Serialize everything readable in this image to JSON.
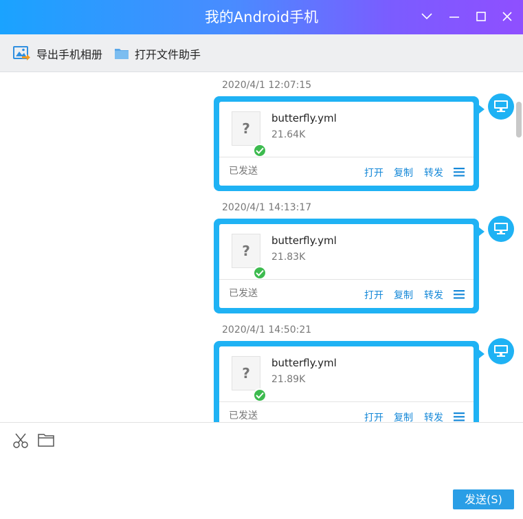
{
  "window": {
    "title": "我的Android手机",
    "controls": [
      {
        "name": "minimize-chevron",
        "icon": "chevron-down-icon"
      },
      {
        "name": "minimize",
        "icon": "minus-icon"
      },
      {
        "name": "maximize",
        "icon": "square-icon"
      },
      {
        "name": "close",
        "icon": "close-icon"
      }
    ]
  },
  "toolbar": {
    "export_album": {
      "label": "导出手机相册",
      "icon": "image-export-icon"
    },
    "open_file_helper": {
      "label": "打开文件助手",
      "icon": "folder-icon"
    }
  },
  "messages": [
    {
      "timestamp": "2020/4/1 12:07:15",
      "file_name": "butterfly.yml",
      "file_size": "21.64K",
      "status": "已发送",
      "actions": {
        "open": "打开",
        "copy": "复制",
        "forward": "转发"
      }
    },
    {
      "timestamp": "2020/4/1 14:13:17",
      "file_name": "butterfly.yml",
      "file_size": "21.83K",
      "status": "已发送",
      "actions": {
        "open": "打开",
        "copy": "复制",
        "forward": "转发"
      }
    },
    {
      "timestamp": "2020/4/1 14:50:21",
      "file_name": "butterfly.yml",
      "file_size": "21.89K",
      "status": "已发送",
      "actions": {
        "open": "打开",
        "copy": "复制",
        "forward": "转发"
      }
    }
  ],
  "input": {
    "icons": [
      "scissors-icon",
      "folder-icon"
    ],
    "send_label": "发送(S)"
  },
  "colors": {
    "accent": "#1fb2f4",
    "link": "#1588d8",
    "success": "#3dbb4f",
    "send_button": "#2a9ee6"
  }
}
